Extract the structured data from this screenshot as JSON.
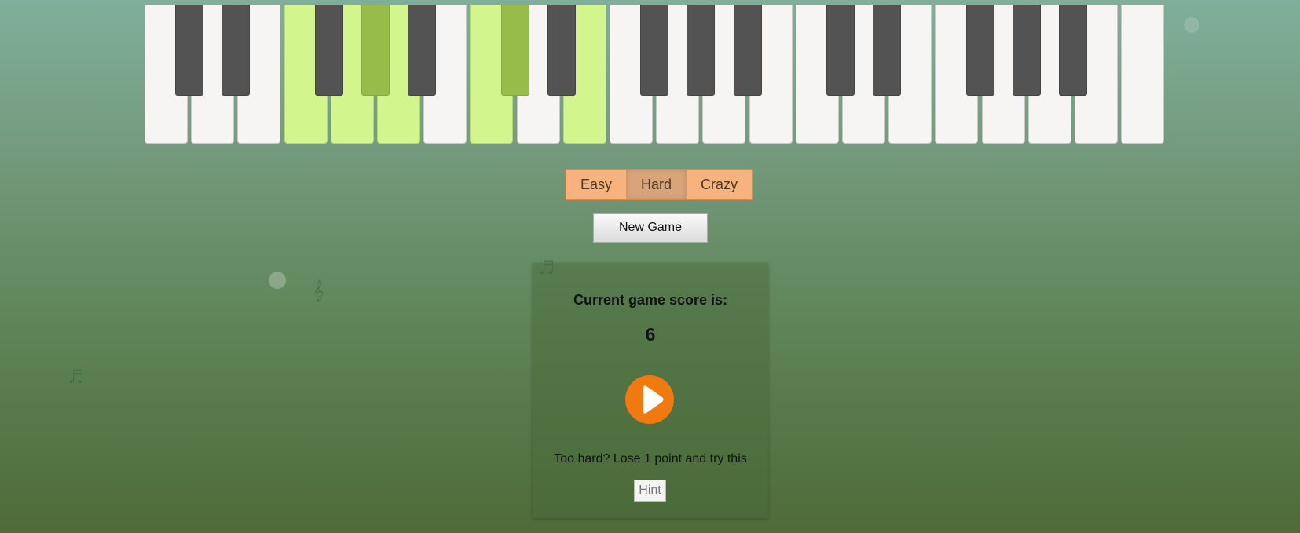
{
  "piano": {
    "white_keys_active": [
      3,
      4,
      5,
      7,
      9
    ],
    "black_keys_active": [
      3,
      5
    ]
  },
  "levels": [
    {
      "label": "Easy",
      "active": false
    },
    {
      "label": "Hard",
      "active": true
    },
    {
      "label": "Crazy",
      "active": false
    }
  ],
  "new_game_label": "New Game",
  "score_panel": {
    "label": "Current game score is:",
    "value": "6",
    "hint_text": "Too hard? Lose 1 point and try this",
    "hint_label": "Hint"
  },
  "decorations": {
    "note_glyph": "♬",
    "clef_glyph": "𝄞"
  },
  "colors": {
    "key_active": "#d3f58e",
    "black_key_active": "#98bc4a",
    "play_button": "#f07a10",
    "level_buttons": "#f6b37d"
  },
  "icons": {
    "play": "play-icon"
  }
}
